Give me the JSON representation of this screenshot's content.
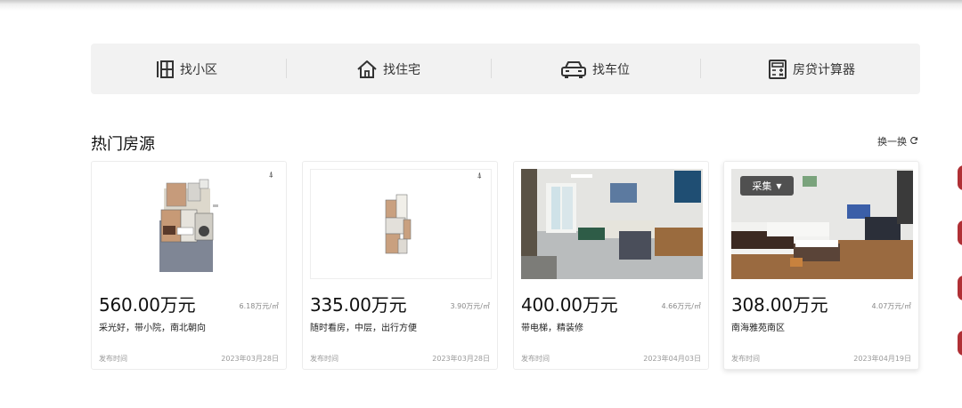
{
  "nav": {
    "items": [
      {
        "label": "找小区",
        "icon": "community-icon"
      },
      {
        "label": "找住宅",
        "icon": "house-icon"
      },
      {
        "label": "找车位",
        "icon": "car-icon"
      },
      {
        "label": "房贷计算器",
        "icon": "calculator-icon"
      }
    ]
  },
  "section": {
    "title": "热门房源",
    "refresh_label": "换一换"
  },
  "listings": [
    {
      "price": "560.00万元",
      "unit_price": "6.18万元/㎡",
      "desc": "采光好，带小院，南北朝向",
      "date_label": "发布时间",
      "date": "2023年03月28日"
    },
    {
      "price": "335.00万元",
      "unit_price": "3.90万元/㎡",
      "desc": "随时看房，中层，出行方便",
      "date_label": "发布时间",
      "date": "2023年03月28日"
    },
    {
      "price": "400.00万元",
      "unit_price": "4.66万元/㎡",
      "desc": "带电梯，精装修",
      "date_label": "发布时间",
      "date": "2023年04月03日"
    },
    {
      "price": "308.00万元",
      "unit_price": "4.07万元/㎡",
      "desc": "南海雅苑南区",
      "date_label": "发布时间",
      "date": "2023年04月19日",
      "collect_label": "采集"
    }
  ],
  "colors": {
    "accent_side": "#b03035",
    "nav_bg": "#f2f2f2"
  }
}
